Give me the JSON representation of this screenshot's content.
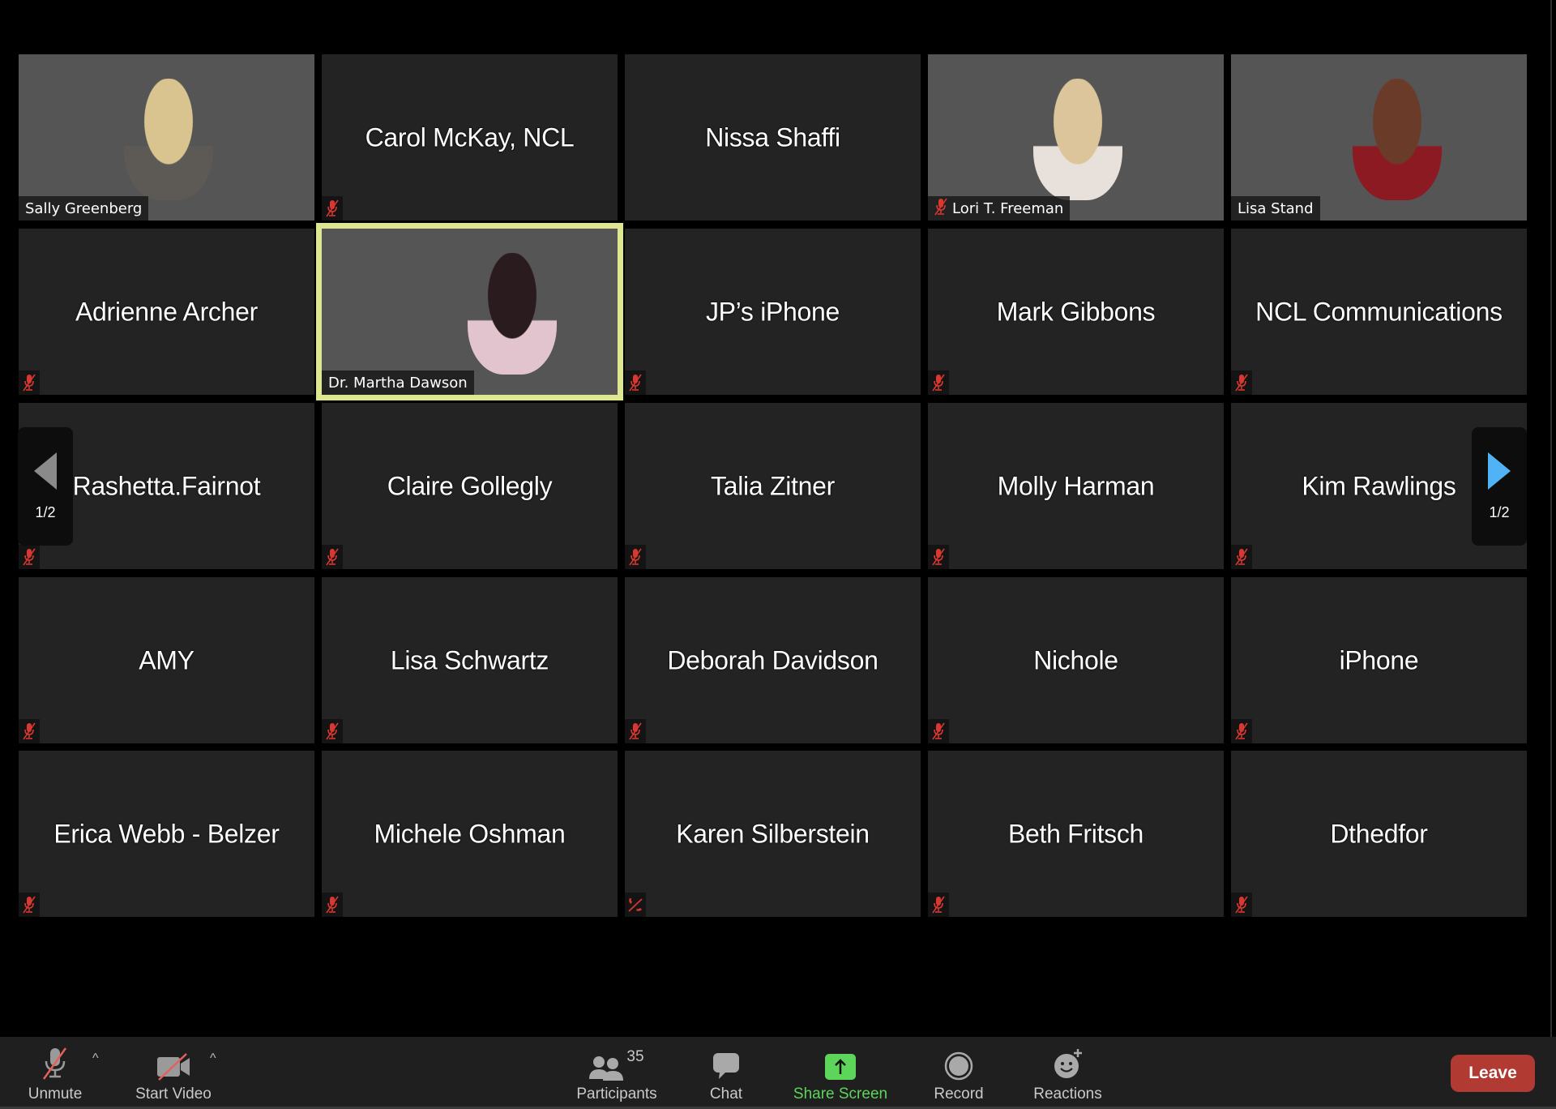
{
  "meeting": {
    "page_indicator": "1/2",
    "participant_count": "35",
    "active_speaker_color": "#dfe690",
    "mute_color": "#d9372f"
  },
  "tiles": [
    {
      "name": "Sally Greenberg",
      "video": true,
      "bg": "sally",
      "muted": false,
      "icon": "none"
    },
    {
      "name": "Carol McKay, NCL",
      "video": false,
      "muted": true,
      "icon": "mic-off"
    },
    {
      "name": "Nissa Shaffi",
      "video": false,
      "muted": false,
      "icon": "none"
    },
    {
      "name": "Lori T. Freeman",
      "video": true,
      "bg": "lori",
      "muted": true,
      "icon": "mic-off"
    },
    {
      "name": "Lisa Stand",
      "video": true,
      "bg": "lisa",
      "muted": false,
      "icon": "none"
    },
    {
      "name": "Adrienne Archer",
      "video": false,
      "muted": true,
      "icon": "mic-off"
    },
    {
      "name": "Dr. Martha Dawson",
      "video": true,
      "bg": "martha",
      "muted": false,
      "icon": "none",
      "active": true
    },
    {
      "name": "JP’s iPhone",
      "video": false,
      "muted": true,
      "icon": "mic-off"
    },
    {
      "name": "Mark Gibbons",
      "video": false,
      "muted": true,
      "icon": "mic-off"
    },
    {
      "name": "NCL Communications",
      "video": false,
      "muted": true,
      "icon": "mic-off"
    },
    {
      "name": "Rashetta.Fairnot",
      "video": false,
      "muted": true,
      "icon": "mic-off"
    },
    {
      "name": "Claire Gollegly",
      "video": false,
      "muted": true,
      "icon": "mic-off"
    },
    {
      "name": "Talia Zitner",
      "video": false,
      "muted": true,
      "icon": "mic-off"
    },
    {
      "name": "Molly Harman",
      "video": false,
      "muted": true,
      "icon": "mic-off"
    },
    {
      "name": "Kim Rawlings",
      "video": false,
      "muted": true,
      "icon": "mic-off"
    },
    {
      "name": "AMY",
      "video": false,
      "muted": true,
      "icon": "mic-off"
    },
    {
      "name": "Lisa Schwartz",
      "video": false,
      "muted": true,
      "icon": "mic-off"
    },
    {
      "name": "Deborah Davidson",
      "video": false,
      "muted": true,
      "icon": "mic-off"
    },
    {
      "name": "Nichole",
      "video": false,
      "muted": true,
      "icon": "mic-off"
    },
    {
      "name": "iPhone",
      "video": false,
      "muted": true,
      "icon": "mic-off"
    },
    {
      "name": "Erica Webb - Belzer",
      "video": false,
      "muted": true,
      "icon": "mic-off"
    },
    {
      "name": "Michele Oshman",
      "video": false,
      "muted": true,
      "icon": "mic-off"
    },
    {
      "name": "Karen Silberstein",
      "video": false,
      "muted": true,
      "icon": "phone-off"
    },
    {
      "name": "Beth Fritsch",
      "video": false,
      "muted": true,
      "icon": "mic-off"
    },
    {
      "name": "Dthedfor",
      "video": false,
      "muted": true,
      "icon": "mic-off"
    }
  ],
  "toolbar": {
    "unmute_label": "Unmute",
    "start_video_label": "Start Video",
    "participants_label": "Participants",
    "chat_label": "Chat",
    "share_screen_label": "Share Screen",
    "record_label": "Record",
    "reactions_label": "Reactions",
    "leave_label": "Leave",
    "share_color": "#5dd55b",
    "leave_color": "#b13a33"
  }
}
